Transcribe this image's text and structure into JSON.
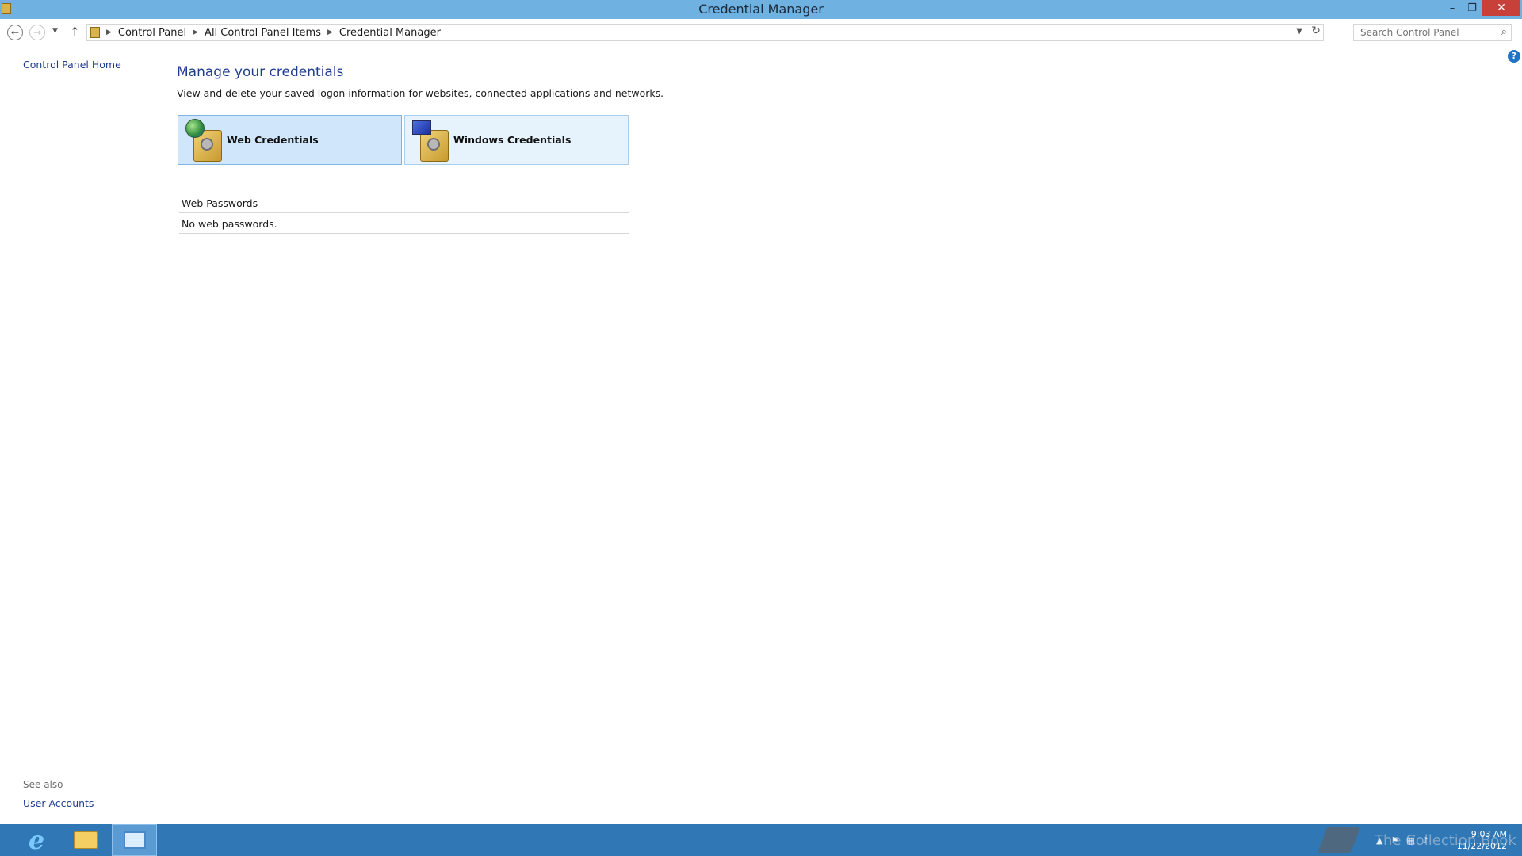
{
  "window": {
    "title": "Credential Manager",
    "minimize": "–",
    "maximize": "❐",
    "close": "✕"
  },
  "navigation": {
    "breadcrumbs": [
      "Control Panel",
      "All Control Panel Items",
      "Credential Manager"
    ],
    "search_placeholder": "Search Control Panel"
  },
  "sidebar": {
    "home_link": "Control Panel Home",
    "see_also_label": "See also",
    "see_also_links": [
      "User Accounts"
    ]
  },
  "main": {
    "heading": "Manage your credentials",
    "description": "View and delete your saved logon information for websites, connected applications and networks.",
    "tiles": [
      {
        "label": "Web Credentials",
        "selected": true
      },
      {
        "label": "Windows Credentials",
        "selected": false
      }
    ],
    "section_title": "Web Passwords",
    "empty_message": "No web passwords."
  },
  "taskbar": {
    "apps": [
      "internet-explorer",
      "file-explorer",
      "control-panel"
    ],
    "watermark": "The Collection Book",
    "clock_time": "9:03 AM",
    "clock_date": "11/22/2012"
  },
  "colors": {
    "titlebar": "#6fb1e0",
    "taskbar": "#2f77b5",
    "link": "#1e3d8f",
    "close_button": "#c7403a",
    "selected_tile": "#cfe6fb"
  }
}
